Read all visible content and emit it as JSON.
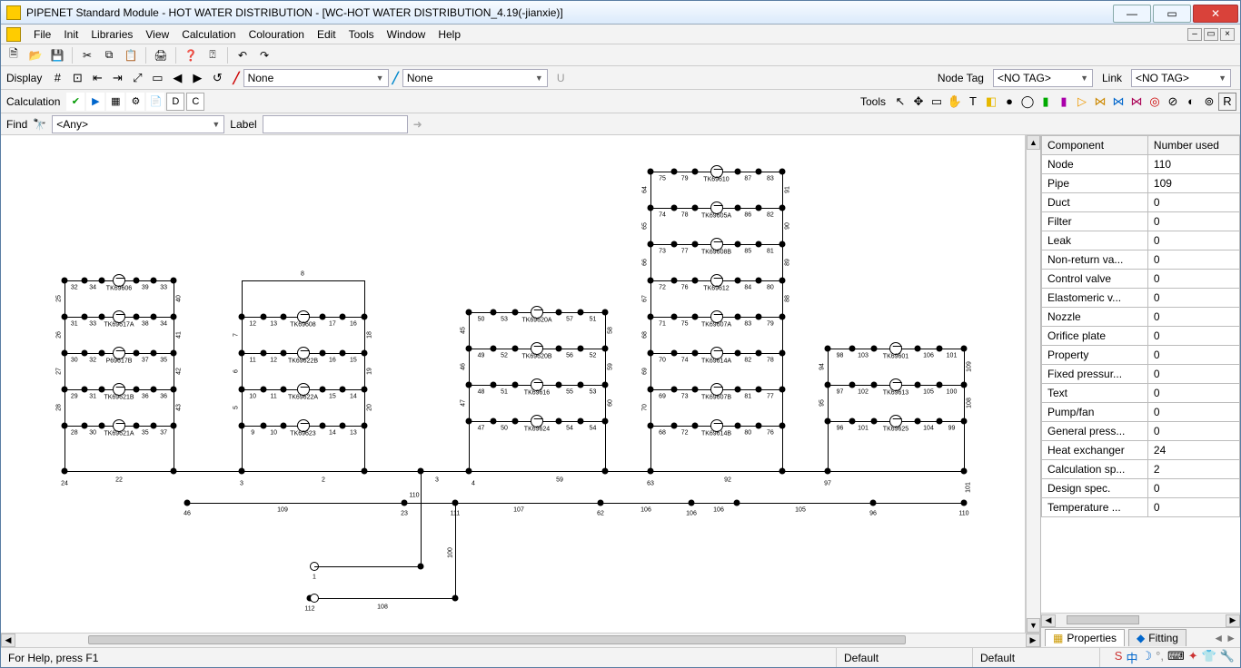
{
  "title": "PIPENET Standard Module - HOT WATER DISTRIBUTION - [WC-HOT WATER DISTRIBUTION_4.19(-jianxie)]",
  "menu": {
    "file": "File",
    "init": "Init",
    "libraries": "Libraries",
    "view": "View",
    "calculation": "Calculation",
    "colouration": "Colouration",
    "edit": "Edit",
    "tools": "Tools",
    "window": "Window",
    "help": "Help"
  },
  "row2": {
    "display": "Display",
    "none1": "None",
    "none2": "None",
    "nodetag": "Node Tag",
    "notag": "<NO TAG>",
    "link": "Link",
    "notag2": "<NO TAG>",
    "u": "U"
  },
  "row3": {
    "calculation": "Calculation",
    "d": "D",
    "c": "C",
    "tools": "Tools"
  },
  "row4": {
    "find": "Find",
    "any": "<Any>",
    "label": "Label"
  },
  "grid": {
    "h1": "Component",
    "h2": "Number used",
    "rows": [
      {
        "k": "Node",
        "v": "110"
      },
      {
        "k": "Pipe",
        "v": "109"
      },
      {
        "k": "Duct",
        "v": "0"
      },
      {
        "k": "Filter",
        "v": "0"
      },
      {
        "k": "Leak",
        "v": "0"
      },
      {
        "k": "Non-return va...",
        "v": "0"
      },
      {
        "k": "Control valve",
        "v": "0"
      },
      {
        "k": "Elastomeric v...",
        "v": "0"
      },
      {
        "k": "Nozzle",
        "v": "0"
      },
      {
        "k": "Orifice plate",
        "v": "0"
      },
      {
        "k": "Property",
        "v": "0"
      },
      {
        "k": "Fixed pressur...",
        "v": "0"
      },
      {
        "k": "Text",
        "v": "0"
      },
      {
        "k": "Pump/fan",
        "v": "0"
      },
      {
        "k": "General press...",
        "v": "0"
      },
      {
        "k": "Heat exchanger",
        "v": "24"
      },
      {
        "k": "Calculation sp...",
        "v": "2"
      },
      {
        "k": "Design spec.",
        "v": "0"
      },
      {
        "k": "Temperature ...",
        "v": "0"
      }
    ]
  },
  "tabs": {
    "properties": "Properties",
    "fitting": "Fitting"
  },
  "status": {
    "help": "For Help, press F1",
    "d1": "Default",
    "d2": "Default"
  },
  "labels": {
    "c1": [
      "TK69606",
      "TK69617A",
      "P69617B",
      "TK69621B",
      "TK69621A"
    ],
    "c2": [
      "TK69608",
      "TK69622B",
      "TK69622A",
      "TK69623"
    ],
    "c3": [
      "TK69620A",
      "TK69620B",
      "TK69616",
      "TK69624"
    ],
    "c4": [
      "TK69610",
      "TK69605A",
      "TK69608B",
      "TK69612",
      "TK69607A",
      "TK69614A",
      "TK69607B",
      "TK69614B"
    ],
    "c5": [
      "TK69601",
      "TK69613",
      "TK69625"
    ]
  },
  "bottom": {
    "n24": "24",
    "n22": "22",
    "n3": "3",
    "n2": "2",
    "n3b": "3",
    "n4": "4",
    "n59": "59",
    "n63": "63",
    "n92": "92",
    "n97": "97",
    "n46": "46",
    "n109": "109",
    "n23": "23",
    "n110": "110",
    "n111": "111",
    "n107": "107",
    "n62": "62",
    "n106": "106",
    "n106b": "106",
    "n106c": "106",
    "n96": "96",
    "n105": "105",
    "n110b": "110",
    "n1": "1",
    "n108": "108",
    "n112": "112",
    "n8": "8"
  }
}
